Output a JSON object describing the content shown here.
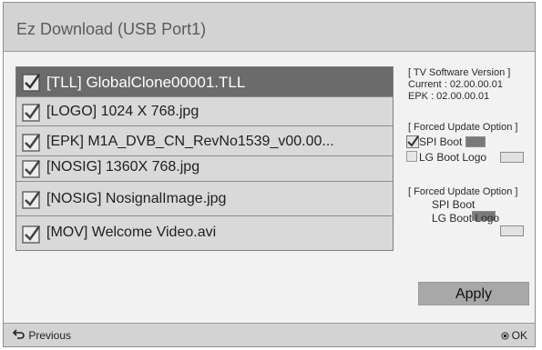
{
  "title": "Ez Download (USB Port1)",
  "files": [
    {
      "label": "[TLL] GlobalClone00001.TLL",
      "checked": true,
      "selected": true
    },
    {
      "label": "[LOGO] 1024 X 768.jpg",
      "checked": true,
      "selected": false
    },
    {
      "label": "[EPK] M1A_DVB_CN_RevNo1539_v00.00...",
      "checked": true,
      "selected": false
    },
    {
      "label": "[NOSIG] 1360X 768.jpg",
      "checked": true,
      "selected": false
    },
    {
      "label": "[NOSIG] NosignalImage.jpg",
      "checked": true,
      "selected": false
    },
    {
      "label": "[MOV] Welcome Video.avi",
      "checked": true,
      "selected": false
    }
  ],
  "version": {
    "header": "[ TV Software Version ]",
    "current": "Current : 02.00.00.01",
    "epk": "EPK : 02.00.00.01"
  },
  "forced1": {
    "header": "[ Forced Update Option ]",
    "spi_boot": "SPI Boot",
    "spi_checked": true,
    "lg_boot_logo": "LG Boot Logo",
    "lg_checked": false
  },
  "forced2": {
    "header": "[ Forced Update Option ]",
    "spi_boot": "SPI Boot",
    "lg_boot_logo": "LG Boot Logo"
  },
  "apply_label": "Apply",
  "footer": {
    "previous_label": "Previous",
    "ok_label": "OK"
  },
  "colors": {
    "selected_row": "#6b6b6b",
    "row": "#d9d9d9",
    "titlebar": "#d3d3d3"
  }
}
